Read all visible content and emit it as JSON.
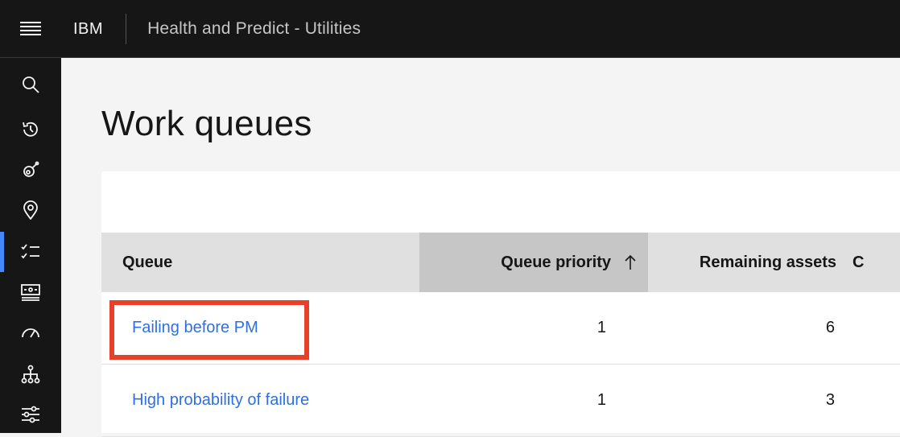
{
  "header": {
    "brand": "IBM",
    "product": "Health and Predict - Utilities"
  },
  "sidenav": {
    "items": [
      {
        "icon": "search-icon",
        "active": false
      },
      {
        "icon": "history-icon",
        "active": false
      },
      {
        "icon": "satellite-icon",
        "active": false
      },
      {
        "icon": "location-icon",
        "active": false
      },
      {
        "icon": "task-list-icon",
        "active": true
      },
      {
        "icon": "dashboard-icon",
        "active": false
      },
      {
        "icon": "meter-icon",
        "active": false
      },
      {
        "icon": "hierarchy-icon",
        "active": false
      },
      {
        "icon": "settings-adjust-icon",
        "active": false
      }
    ],
    "active_color": "#4589ff"
  },
  "main": {
    "title": "Work queues",
    "table": {
      "columns": [
        "Queue",
        "Queue priority",
        "Remaining assets",
        "C"
      ],
      "sorted_column": "Queue priority",
      "sort_direction": "ascending",
      "rows": [
        {
          "queue": "Failing before PM",
          "priority": "1",
          "remaining": "6",
          "highlighted": true
        },
        {
          "queue": "High probability of failure",
          "priority": "1",
          "remaining": "3",
          "highlighted": false
        }
      ]
    }
  },
  "colors": {
    "link": "#2f6fe0",
    "highlight_border": "#e8402b",
    "header_bg": "#161616"
  }
}
